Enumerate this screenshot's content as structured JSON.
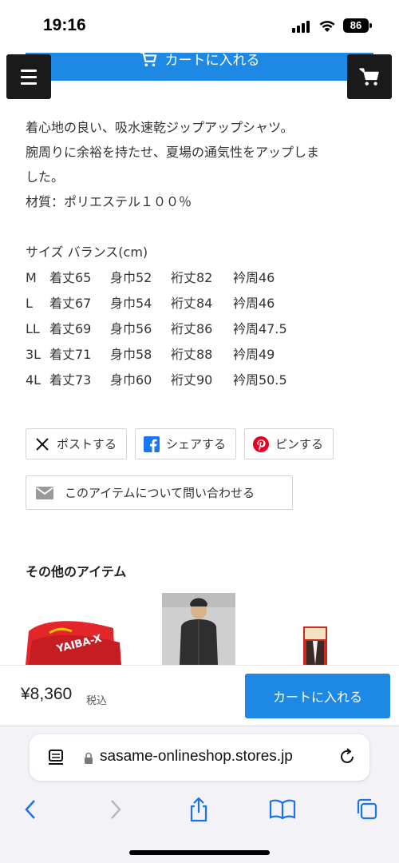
{
  "status_bar": {
    "time": "19:16",
    "battery": "86"
  },
  "top_cart_label": "カートに入れる",
  "description": {
    "lines": [
      "着心地の良い、吸水速乾ジップアップシャツ。",
      "腕周りに余裕を持たせ、夏場の通気性をアップしま",
      "した。",
      "材質：ポリエステル１００％"
    ]
  },
  "sizes": {
    "title": "サイズ バランス(cm)",
    "rows": [
      {
        "size": "M",
        "length": "着丈65",
        "width": "身巾52",
        "sleeve": "裄丈82",
        "neck": "衿周46"
      },
      {
        "size": "L",
        "length": "着丈67",
        "width": "身巾54",
        "sleeve": "裄丈84",
        "neck": "衿周46"
      },
      {
        "size": "LL",
        "length": "着丈69",
        "width": "身巾56",
        "sleeve": "裄丈86",
        "neck": "衿周47.5"
      },
      {
        "size": "3L",
        "length": "着丈71",
        "width": "身巾58",
        "sleeve": "裄丈88",
        "neck": "衿周49"
      },
      {
        "size": "4L",
        "length": "着丈73",
        "width": "身巾60",
        "sleeve": "裄丈90",
        "neck": "衿周50.5"
      }
    ]
  },
  "share": {
    "post": "ポストする",
    "share": "シェアする",
    "pin": "ピンする",
    "contact": "このアイテムについて問い合わせる"
  },
  "other_items": {
    "title": "その他のアイテム",
    "thumb1_text": "YAIBA-X"
  },
  "purchase": {
    "price": "¥8,360",
    "tax": "税込",
    "button": "カートに入れる"
  },
  "browser": {
    "url": "sasame-onlineshop.stores.jp"
  },
  "colors": {
    "accent": "#1e88e5",
    "dark": "#1a1a1a",
    "pinterest": "#e60023",
    "facebook": "#1877f2"
  }
}
